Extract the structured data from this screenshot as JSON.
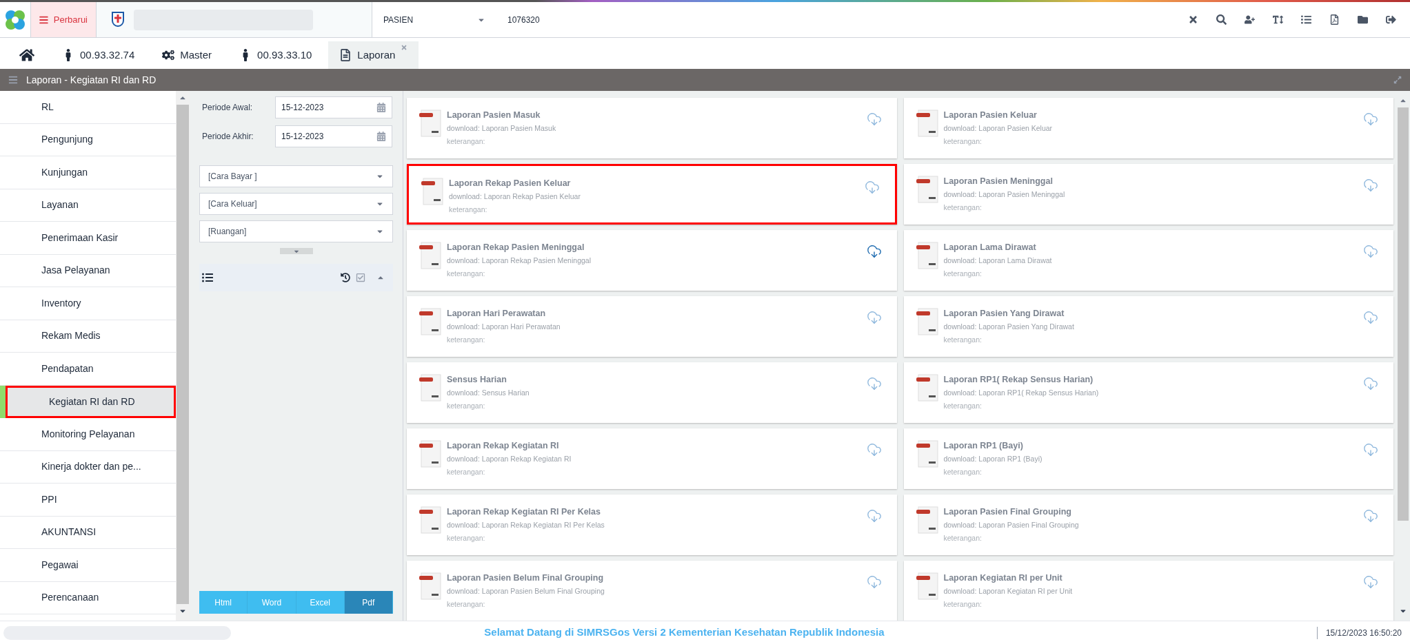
{
  "topbar": {
    "menu_button": "Perbarui",
    "search_type": "PASIEN",
    "search_value": "1076320"
  },
  "tabs": [
    {
      "kind": "home",
      "selected": false,
      "closable": false
    },
    {
      "kind": "person",
      "label": "00.93.32.74",
      "selected": false,
      "closable": false
    },
    {
      "kind": "gears",
      "label": "Master",
      "selected": false,
      "closable": false
    },
    {
      "kind": "person",
      "label": "00.93.33.10",
      "selected": false,
      "closable": false
    },
    {
      "kind": "document",
      "label": "Laporan",
      "selected": true,
      "closable": true
    }
  ],
  "panel_title": "Laporan - Kegiatan RI dan RD",
  "sidebar": {
    "items": [
      {
        "label": "RL",
        "selected": false
      },
      {
        "label": "Pengunjung",
        "selected": false
      },
      {
        "label": "Kunjungan",
        "selected": false
      },
      {
        "label": "Layanan",
        "selected": false
      },
      {
        "label": "Penerimaan Kasir",
        "selected": false
      },
      {
        "label": "Jasa Pelayanan",
        "selected": false
      },
      {
        "label": "Inventory",
        "selected": false
      },
      {
        "label": "Rekam Medis",
        "selected": false
      },
      {
        "label": "Pendapatan",
        "selected": false
      },
      {
        "label": "Kegiatan RI dan RD",
        "selected": true
      },
      {
        "label": "Monitoring Pelayanan",
        "selected": false
      },
      {
        "label": "Kinerja dokter dan pe...",
        "selected": false
      },
      {
        "label": "PPI",
        "selected": false
      },
      {
        "label": "AKUNTANSI",
        "selected": false
      },
      {
        "label": "Pegawai",
        "selected": false
      },
      {
        "label": "Perencanaan",
        "selected": false
      }
    ]
  },
  "filters": {
    "dates": [
      {
        "label": "Periode Awal:",
        "value": "15-12-2023"
      },
      {
        "label": "Periode Akhir:",
        "value": "15-12-2023"
      }
    ],
    "selects": [
      {
        "placeholder": "[Cara Bayar ]"
      },
      {
        "placeholder": "[Cara Keluar]"
      },
      {
        "placeholder": "[Ruangan]"
      }
    ],
    "formats": [
      {
        "label": "Html",
        "selected": false
      },
      {
        "label": "Word",
        "selected": false
      },
      {
        "label": "Excel",
        "selected": false
      },
      {
        "label": "Pdf",
        "selected": true
      }
    ]
  },
  "reports": [
    {
      "title": "Laporan Pasien Masuk",
      "download": "download: Laporan Pasien Masuk",
      "note": "keterangan:",
      "highlighted": false,
      "hovered": false
    },
    {
      "title": "Laporan Pasien Keluar",
      "download": "download: Laporan Pasien Keluar",
      "note": "keterangan:",
      "highlighted": false,
      "hovered": false
    },
    {
      "title": "Laporan Rekap Pasien Keluar",
      "download": "download: Laporan Rekap Pasien Keluar",
      "note": "keterangan:",
      "highlighted": true,
      "hovered": false
    },
    {
      "title": "Laporan Pasien Meninggal",
      "download": "download: Laporan Pasien Meninggal",
      "note": "keterangan:",
      "highlighted": false,
      "hovered": false
    },
    {
      "title": "Laporan Rekap Pasien Meninggal",
      "download": "download: Laporan Rekap Pasien Meninggal",
      "note": "keterangan:",
      "highlighted": false,
      "hovered": true
    },
    {
      "title": "Laporan Lama Dirawat",
      "download": "download: Laporan Lama Dirawat",
      "note": "keterangan:",
      "highlighted": false,
      "hovered": false
    },
    {
      "title": "Laporan Hari Perawatan",
      "download": "download: Laporan Hari Perawatan",
      "note": "keterangan:",
      "highlighted": false,
      "hovered": false
    },
    {
      "title": "Laporan Pasien Yang Dirawat",
      "download": "download: Laporan Pasien Yang Dirawat",
      "note": "keterangan:",
      "highlighted": false,
      "hovered": false
    },
    {
      "title": "Sensus Harian",
      "download": "download: Sensus Harian",
      "note": "keterangan:",
      "highlighted": false,
      "hovered": false
    },
    {
      "title": "Laporan RP1( Rekap Sensus Harian)",
      "download": "download: Laporan RP1( Rekap Sensus Harian)",
      "note": "keterangan:",
      "highlighted": false,
      "hovered": false
    },
    {
      "title": "Laporan Rekap Kegiatan RI",
      "download": "download: Laporan Rekap Kegiatan RI",
      "note": "keterangan:",
      "highlighted": false,
      "hovered": false
    },
    {
      "title": "Laporan RP1 (Bayi)",
      "download": "download: Laporan RP1 (Bayi)",
      "note": "keterangan:",
      "highlighted": false,
      "hovered": false
    },
    {
      "title": "Laporan Rekap Kegiatan RI Per Kelas",
      "download": "download: Laporan Rekap Kegiatan RI Per Kelas",
      "note": "keterangan:",
      "highlighted": false,
      "hovered": false
    },
    {
      "title": "Laporan Pasien Final Grouping",
      "download": "download: Laporan Pasien Final Grouping",
      "note": "keterangan:",
      "highlighted": false,
      "hovered": false
    },
    {
      "title": "Laporan Pasien Belum Final Grouping",
      "download": "download: Laporan Pasien Belum Final Grouping",
      "note": "keterangan:",
      "highlighted": false,
      "hovered": false
    },
    {
      "title": "Laporan Kegiatan RI per Unit",
      "download": "download: Laporan Kegiatan RI per Unit",
      "note": "keterangan:",
      "highlighted": false,
      "hovered": false
    }
  ],
  "status_bar": {
    "message": "Selamat Datang di SIMRSGos Versi 2 Kementerian Kesehatan Republik Indonesia",
    "datetime": "15/12/2023 16:50:20"
  }
}
